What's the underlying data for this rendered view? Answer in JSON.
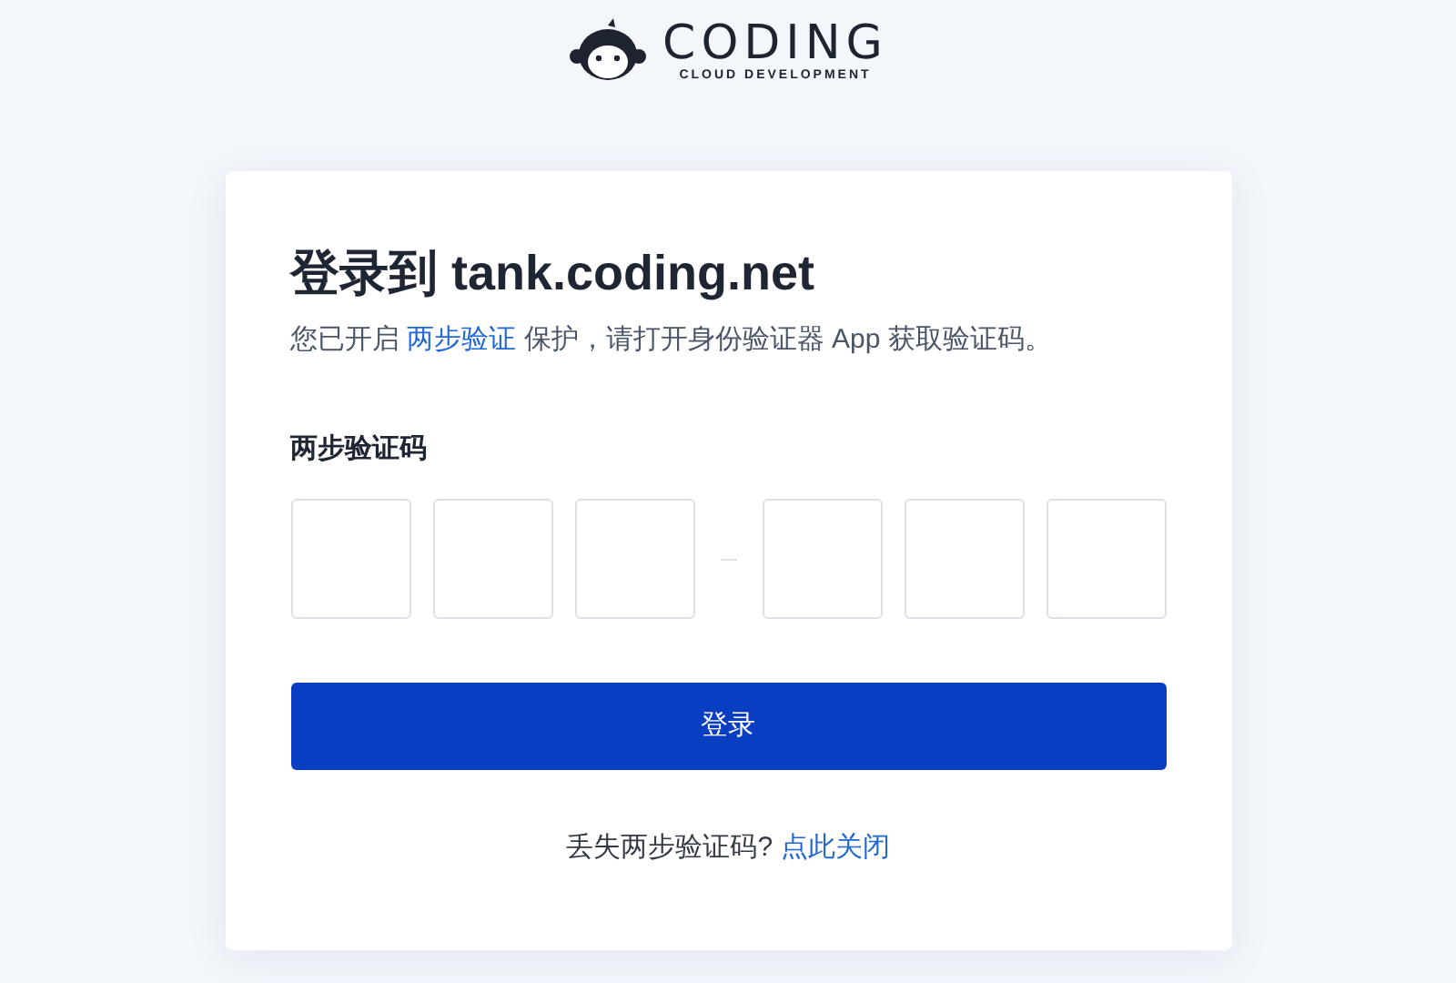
{
  "logo": {
    "name": "CODING",
    "tagline": "CLOUD DEVELOPMENT"
  },
  "card": {
    "title": "登录到 tank.coding.net",
    "instruction": {
      "before": "您已开启 ",
      "link": "两步验证",
      "after": " 保护，请打开身份验证器 App 获取验证码。"
    },
    "code_label": "两步验证码",
    "code_groups": [
      {
        "fields": [
          {
            "filled": false
          },
          {
            "filled": false
          },
          {
            "filled": false
          }
        ]
      },
      {
        "fields": [
          {
            "filled": false
          },
          {
            "filled": false
          },
          {
            "filled": false
          }
        ]
      }
    ],
    "submit_button": "登录",
    "footer": {
      "text": "丢失两步验证码?",
      "link": "点此关闭"
    }
  }
}
